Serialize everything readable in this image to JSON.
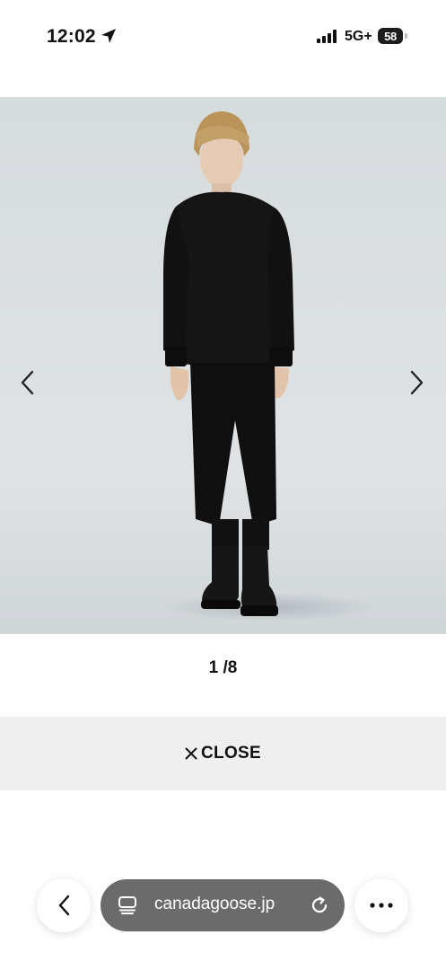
{
  "status_bar": {
    "time": "12:02",
    "network": "5G+",
    "battery": "58",
    "icons": [
      "location-arrow-icon",
      "signal-bars-icon",
      "battery-icon"
    ]
  },
  "gallery": {
    "prev_icon": "chevron-left-icon",
    "next_icon": "chevron-right-icon",
    "pager": "1 /8"
  },
  "close_button": {
    "icon": "close-icon",
    "label": "CLOSE"
  },
  "browser": {
    "back_icon": "chevron-left-icon",
    "tabs_icon": "tabs-icon",
    "url": "canadagoose.jp",
    "reload_icon": "reload-icon",
    "more_icon": "more-icon"
  },
  "colors": {
    "close_bar_bg": "#efefef",
    "url_pill_bg": "#6b6b6b",
    "photo_bg": "#d8dde0"
  }
}
